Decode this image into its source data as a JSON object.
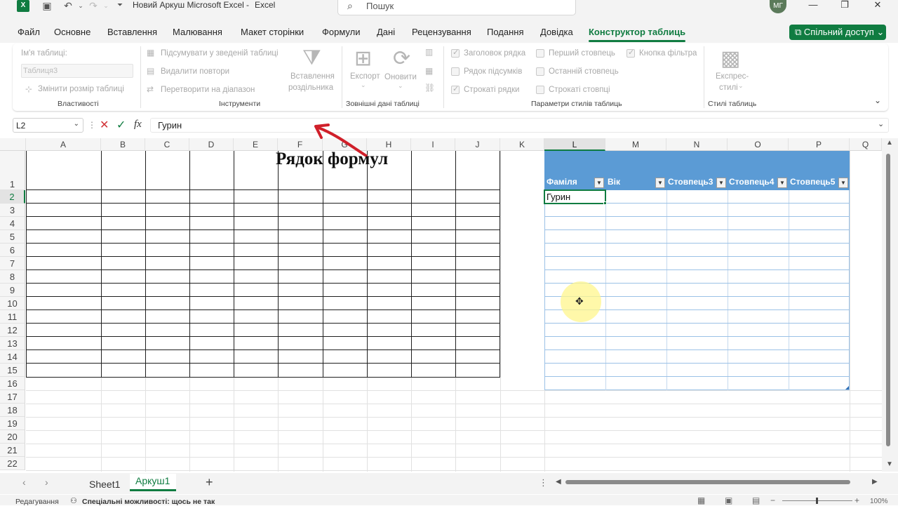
{
  "title": {
    "document": "Новий Аркуш Microsoft Excel",
    "separator": "-",
    "app": "Excel",
    "search_placeholder": "Пошук",
    "user_initials": "МГ"
  },
  "menu": {
    "file": "Файл",
    "home": "Основне",
    "insert": "Вставлення",
    "draw": "Малювання",
    "page_layout": "Макет сторінки",
    "formulas": "Формули",
    "data": "Дані",
    "review": "Рецензування",
    "view": "Подання",
    "help": "Довідка",
    "table_design": "Конструктор таблиць",
    "share": "Спільний доступ"
  },
  "ribbon": {
    "table_name_label": "Ім'я таблиці:",
    "table_name_value": "Таблиця3",
    "resize_table": "Змінити розмір таблиці",
    "group_properties": "Властивості",
    "summarize_pivot": "Підсумувати у зведеній таблиці",
    "remove_duplicates": "Видалити повтори",
    "convert_range": "Перетворити на діапазон",
    "insert_slicer_1": "Вставлення",
    "insert_slicer_2": "роздільника",
    "group_tools": "Інструменти",
    "export": "Експорт",
    "refresh": "Оновити",
    "group_external": "Зовнішні дані таблиці",
    "header_row": "Заголовок рядка",
    "total_row": "Рядок підсумків",
    "banded_rows": "Строкаті рядки",
    "first_column": "Перший стовпець",
    "last_column": "Останній стовпець",
    "banded_columns": "Строкаті стовпці",
    "filter_button": "Кнопка фільтра",
    "group_style_options": "Параметри стилів таблиць",
    "quick_styles_1": "Експрес-",
    "quick_styles_2": "стилі",
    "group_table_styles": "Стилі таблиць"
  },
  "formula_bar": {
    "name_box": "L2",
    "fx": "fx",
    "value": "Гурин"
  },
  "columns": [
    "A",
    "B",
    "C",
    "D",
    "E",
    "F",
    "G",
    "H",
    "I",
    "J",
    "K",
    "L",
    "M",
    "N",
    "O",
    "P",
    "Q"
  ],
  "rows": [
    "1",
    "2",
    "3",
    "4",
    "5",
    "6",
    "7",
    "8",
    "9",
    "10",
    "11",
    "12",
    "13",
    "14",
    "15",
    "16",
    "17",
    "18",
    "19",
    "20",
    "21",
    "22"
  ],
  "table_headers": [
    "Фаміля",
    "Вік",
    "Стовпець3",
    "Стовпець4",
    "Стовпець5"
  ],
  "active_cell_value": "Гурин",
  "annotation": "Рядок формул",
  "sheets": [
    "Sheet1",
    "Аркуш1"
  ],
  "status": {
    "mode": "Редагування",
    "accessibility": "Спеціальні можливості: щось не так",
    "zoom": "100%"
  },
  "colors": {
    "accent": "#107c41",
    "table_header": "#5b9bd5",
    "annotation_arrow": "#d0202a"
  }
}
